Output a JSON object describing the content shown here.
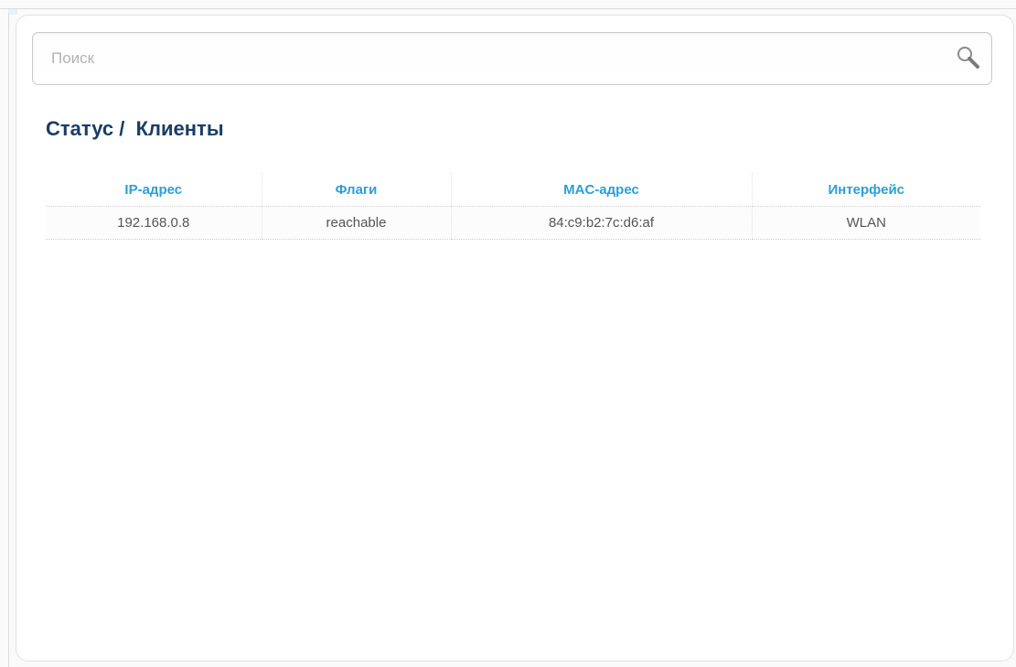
{
  "search": {
    "placeholder": "Поиск",
    "value": "",
    "icon": "search-icon"
  },
  "breadcrumb": {
    "section": "Статус",
    "separator": " /  ",
    "page": "Клиенты"
  },
  "table": {
    "columns": [
      "IP-адрес",
      "Флаги",
      "MAC-адрес",
      "Интерфейс"
    ],
    "rows": [
      [
        "192.168.0.8",
        "reachable",
        "84:c9:b2:7c:d6:af",
        "WLAN"
      ]
    ]
  },
  "colors": {
    "title": "#1a3d66",
    "header": "#2a9fd8",
    "cell_text": "#555555"
  }
}
